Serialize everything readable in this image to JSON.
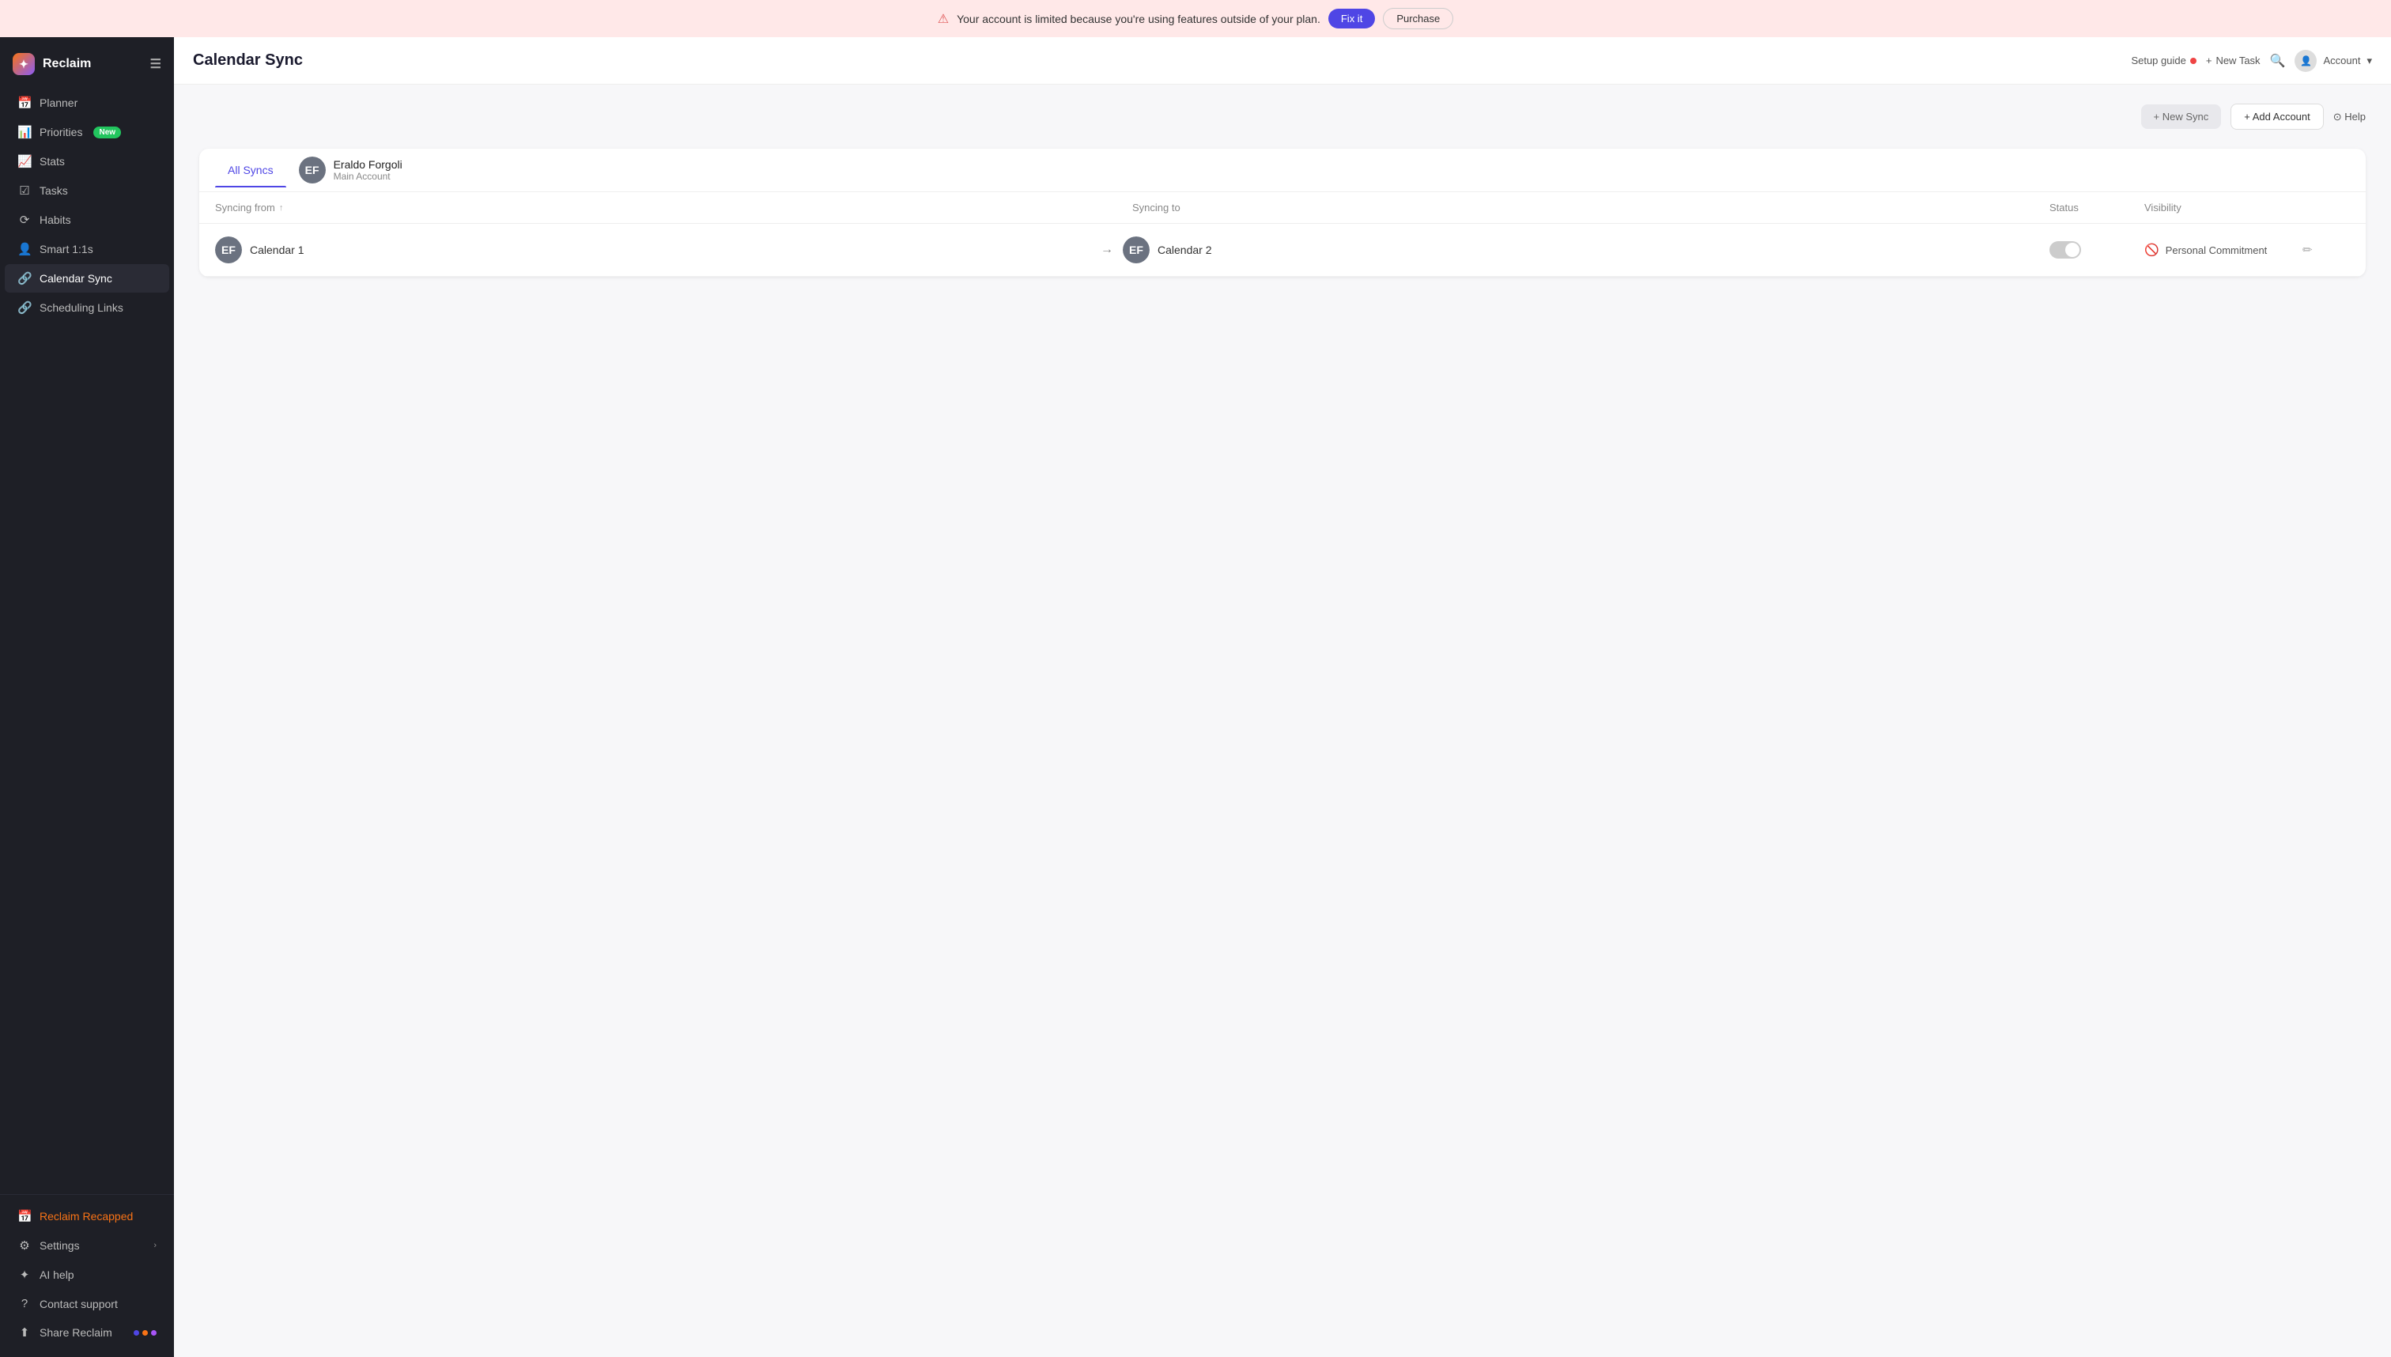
{
  "banner": {
    "message": "Your account is limited because you're using features outside of your plan.",
    "fix_label": "Fix it",
    "purchase_label": "Purchase"
  },
  "sidebar": {
    "logo": "Reclaim",
    "nav_items": [
      {
        "id": "planner",
        "label": "Planner",
        "icon": "📅"
      },
      {
        "id": "priorities",
        "label": "Priorities",
        "icon": "📊",
        "badge": "New"
      },
      {
        "id": "stats",
        "label": "Stats",
        "icon": "📈"
      },
      {
        "id": "tasks",
        "label": "Tasks",
        "icon": "☑️"
      },
      {
        "id": "habits",
        "label": "Habits",
        "icon": "🔄"
      },
      {
        "id": "smart-1on1s",
        "label": "Smart 1:1s",
        "icon": "👤"
      },
      {
        "id": "calendar-sync",
        "label": "Calendar Sync",
        "icon": "🔗"
      },
      {
        "id": "scheduling-links",
        "label": "Scheduling Links",
        "icon": "🔗"
      }
    ],
    "bottom_items": [
      {
        "id": "reclaim-recapped",
        "label": "Reclaim Recapped",
        "icon": "📅",
        "special": "orange"
      },
      {
        "id": "settings",
        "label": "Settings",
        "icon": "⚙️",
        "has_arrow": true
      },
      {
        "id": "ai-help",
        "label": "AI help",
        "icon": "✨"
      },
      {
        "id": "contact-support",
        "label": "Contact support",
        "icon": "❓"
      },
      {
        "id": "share-reclaim",
        "label": "Share Reclaim",
        "icon": "⬆️",
        "has_dots": true
      }
    ]
  },
  "header": {
    "title": "Calendar Sync",
    "setup_guide": "Setup guide",
    "new_task": "New Task",
    "account": "Account"
  },
  "toolbar": {
    "new_sync_label": "+ New Sync",
    "add_account_label": "+ Add Account",
    "help_label": "⊙ Help"
  },
  "tabs": {
    "all_syncs": "All Syncs",
    "account_name": "Eraldo Forgoli",
    "account_sub": "Main Account"
  },
  "table": {
    "col_syncing_from": "Syncing from",
    "col_syncing_to": "Syncing to",
    "col_status": "Status",
    "col_visibility": "Visibility",
    "rows": [
      {
        "from": "Calendar 1",
        "to": "Calendar 2",
        "status_on": false,
        "visibility": "Personal Commitment"
      }
    ]
  }
}
